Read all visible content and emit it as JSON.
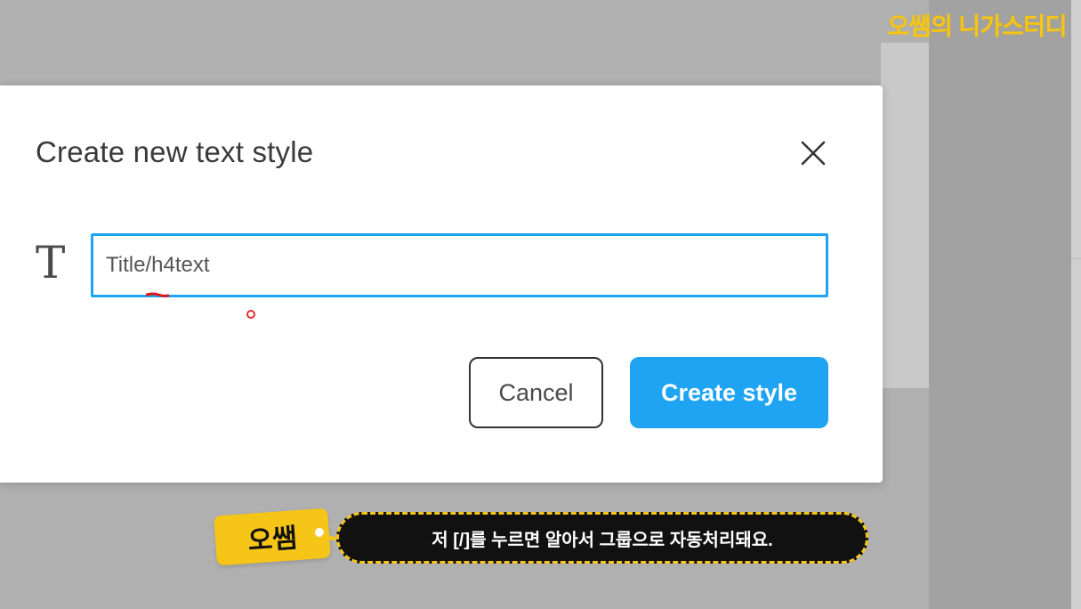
{
  "dialog": {
    "title": "Create new text style",
    "type_icon_glyph": "T",
    "name_input_value": "Title/h4text",
    "cancel_label": "Cancel",
    "create_label": "Create style"
  },
  "overlay": {
    "watermark": "오쌤의 니가스터디",
    "speaker": "오쌤",
    "caption": "저 [/]를 누르면 알아서 그룹으로 자동처리돼요."
  },
  "icons": {
    "close": "close-icon",
    "type": "text-type-icon"
  },
  "colors": {
    "accent": "#1ea4f2",
    "overlay_yellow": "#f5c518",
    "backdrop": "#b0b0b0"
  }
}
